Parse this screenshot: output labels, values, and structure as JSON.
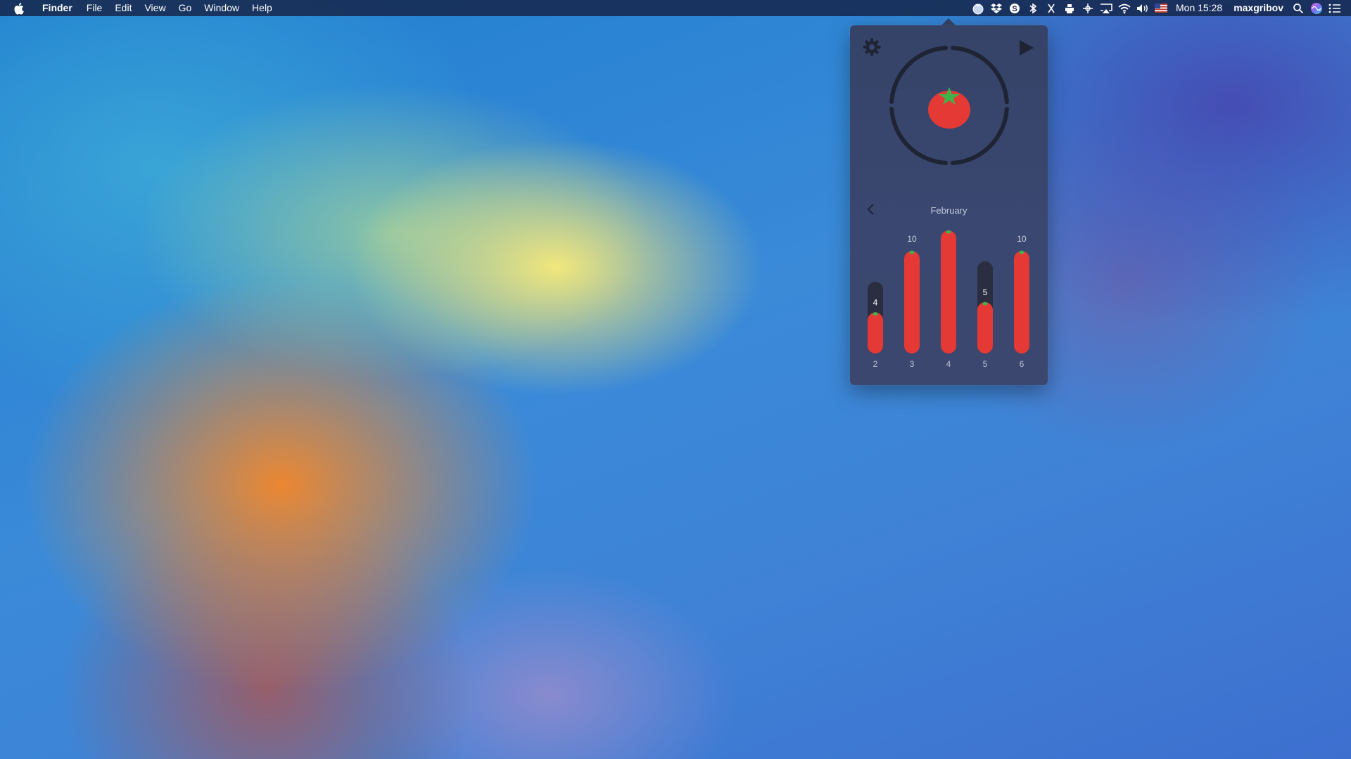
{
  "menubar": {
    "app_name": "Finder",
    "menus": [
      "File",
      "Edit",
      "View",
      "Go",
      "Window",
      "Help"
    ],
    "tray_icons": [
      "pomodoro-tomato-icon",
      "dropbox-icon",
      "skype-icon",
      "bluetooth-icon",
      "text-cursor-icon",
      "printer-icon",
      "wifi-radar-icon",
      "airplay-icon",
      "wifi-icon",
      "volume-icon",
      "us-flag-icon"
    ],
    "clock": "Mon 15:28",
    "user": "maxgribov",
    "search_icon": "search-icon",
    "siri_icon": "siri-icon",
    "notification_icon": "notification-center-icon"
  },
  "popover": {
    "month": "February",
    "colors": {
      "tomato": "#e53935",
      "leaf": "#43b14a",
      "track": "#2a2e40",
      "ring": "#1f2434"
    }
  },
  "chart_data": {
    "type": "bar",
    "categories": [
      "2",
      "3",
      "4",
      "5",
      "6"
    ],
    "values": [
      4,
      10,
      12,
      5,
      10
    ],
    "goal": [
      7,
      10,
      12,
      9,
      10
    ],
    "ylim": [
      0,
      12
    ]
  }
}
